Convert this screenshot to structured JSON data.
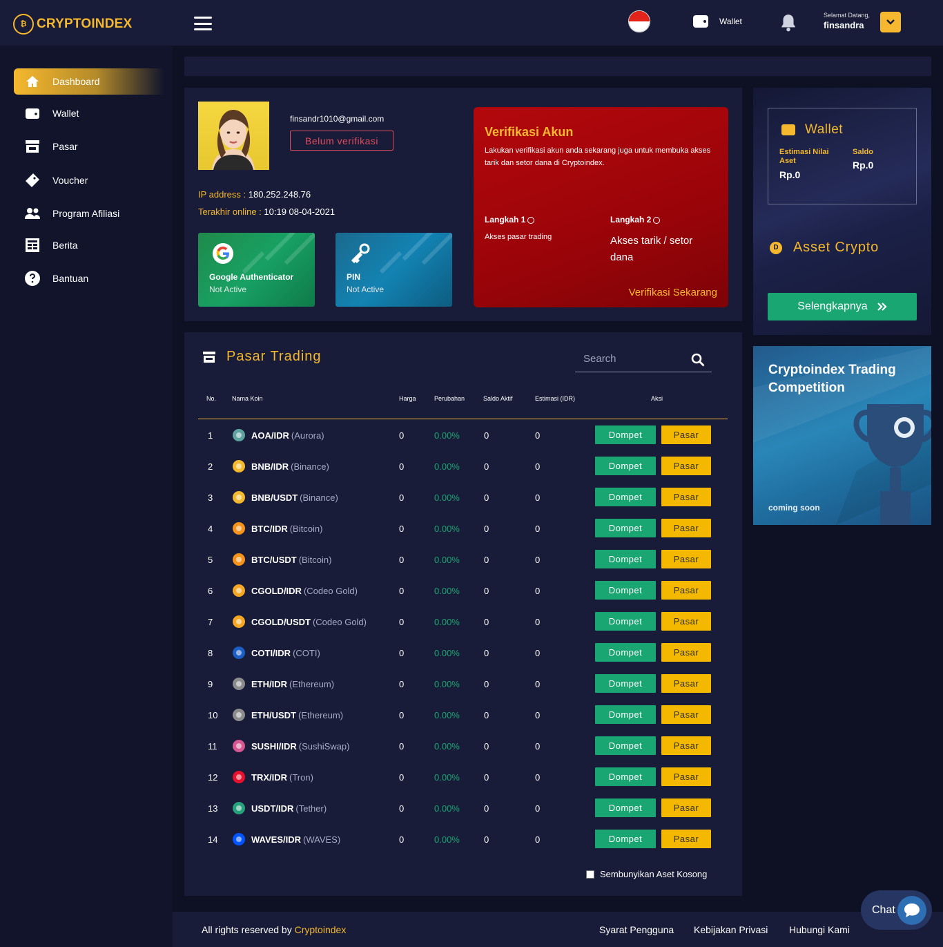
{
  "brand": {
    "name": "CRYPTOINDEX"
  },
  "topbar": {
    "wallet_label": "Wallet",
    "greeting": "Selamat Datang,",
    "username": "finsandra"
  },
  "sidebar": {
    "items": [
      {
        "label": "Dashboard",
        "icon": "home-icon",
        "active": true
      },
      {
        "label": "Wallet",
        "icon": "wallet-icon"
      },
      {
        "label": "Pasar",
        "icon": "store-icon"
      },
      {
        "label": "Voucher",
        "icon": "ticket-icon"
      },
      {
        "label": "Program Afiliasi",
        "icon": "users-icon"
      },
      {
        "label": "Berita",
        "icon": "news-icon"
      },
      {
        "label": "Bantuan",
        "icon": "help-icon"
      }
    ]
  },
  "profile": {
    "email": "finsandr1010@gmail.com",
    "status": "Belum verifikasi",
    "ip_label": "IP address :",
    "ip_value": "180.252.248.76",
    "online_label": "Terakhir online :",
    "online_value": "10:19 08-04-2021"
  },
  "security": {
    "google": {
      "title": "Google Authenticator",
      "status": "Not Active"
    },
    "pin": {
      "title": "PIN",
      "status": "Not Active"
    }
  },
  "verification": {
    "title": "Verifikasi Akun",
    "description": "Lakukan verifikasi akun anda sekarang juga untuk membuka akses tarik dan setor dana di Cryptoindex.",
    "step1_label": "Langkah 1",
    "step1_desc": "Akses pasar trading",
    "step2_label": "Langkah 2",
    "step2_desc": "Akses tarik / setor dana",
    "cta": "Verifikasi Sekarang"
  },
  "wallet_card": {
    "title": "Wallet",
    "estimate_label": "Estimasi Nilai Aset",
    "estimate_value": "Rp.0",
    "saldo_label": "Saldo",
    "saldo_value": "Rp.0",
    "asset_title": "Asset Crypto",
    "more_label": "Selengkapnya"
  },
  "promo": {
    "title": "Cryptoindex Trading Competition",
    "subtitle": "coming soon"
  },
  "market": {
    "title": "Pasar Trading",
    "search_placeholder": "Search",
    "columns": {
      "no": "No.",
      "name": "Nama Koin",
      "price": "Harga",
      "change": "Perubahan",
      "balance": "Saldo Aktif",
      "estimate": "Estimasi (IDR)",
      "action": "Aksi"
    },
    "wallet_btn": "Dompet",
    "market_btn": "Pasar",
    "rows": [
      {
        "no": "1",
        "pair": "AOA/IDR",
        "full": "(Aurora)",
        "price": "0",
        "change": "0.00%",
        "balance": "0",
        "estimate": "0",
        "color": "#5fa3a0"
      },
      {
        "no": "2",
        "pair": "BNB/IDR",
        "full": "(Binance)",
        "price": "0",
        "change": "0.00%",
        "balance": "0",
        "estimate": "0",
        "color": "#f3ba2f"
      },
      {
        "no": "3",
        "pair": "BNB/USDT",
        "full": "(Binance)",
        "price": "0",
        "change": "0.00%",
        "balance": "0",
        "estimate": "0",
        "color": "#f3ba2f"
      },
      {
        "no": "4",
        "pair": "BTC/IDR",
        "full": "(Bitcoin)",
        "price": "0",
        "change": "0.00%",
        "balance": "0",
        "estimate": "0",
        "color": "#f7931a"
      },
      {
        "no": "5",
        "pair": "BTC/USDT",
        "full": "(Bitcoin)",
        "price": "0",
        "change": "0.00%",
        "balance": "0",
        "estimate": "0",
        "color": "#f7931a"
      },
      {
        "no": "6",
        "pair": "CGOLD/IDR",
        "full": "(Codeo Gold)",
        "price": "0",
        "change": "0.00%",
        "balance": "0",
        "estimate": "0",
        "color": "#f5a623"
      },
      {
        "no": "7",
        "pair": "CGOLD/USDT",
        "full": "(Codeo Gold)",
        "price": "0",
        "change": "0.00%",
        "balance": "0",
        "estimate": "0",
        "color": "#f5a623"
      },
      {
        "no": "8",
        "pair": "COTI/IDR",
        "full": "(COTI)",
        "price": "0",
        "change": "0.00%",
        "balance": "0",
        "estimate": "0",
        "color": "#1c5fc4"
      },
      {
        "no": "9",
        "pair": "ETH/IDR",
        "full": "(Ethereum)",
        "price": "0",
        "change": "0.00%",
        "balance": "0",
        "estimate": "0",
        "color": "#8c8c8c"
      },
      {
        "no": "10",
        "pair": "ETH/USDT",
        "full": "(Ethereum)",
        "price": "0",
        "change": "0.00%",
        "balance": "0",
        "estimate": "0",
        "color": "#8c8c8c"
      },
      {
        "no": "11",
        "pair": "SUSHI/IDR",
        "full": "(SushiSwap)",
        "price": "0",
        "change": "0.00%",
        "balance": "0",
        "estimate": "0",
        "color": "#d65892"
      },
      {
        "no": "12",
        "pair": "TRX/IDR",
        "full": "(Tron)",
        "price": "0",
        "change": "0.00%",
        "balance": "0",
        "estimate": "0",
        "color": "#e8112d"
      },
      {
        "no": "13",
        "pair": "USDT/IDR",
        "full": "(Tether)",
        "price": "0",
        "change": "0.00%",
        "balance": "0",
        "estimate": "0",
        "color": "#26a17b"
      },
      {
        "no": "14",
        "pair": "WAVES/IDR",
        "full": "(WAVES)",
        "price": "0",
        "change": "0.00%",
        "balance": "0",
        "estimate": "0",
        "color": "#0155ff"
      }
    ],
    "hide_empty_label": "Sembunyikan Aset Kosong"
  },
  "footer": {
    "copyright": "All rights reserved by",
    "brand": "Cryptoindex",
    "links": [
      "Syarat Pengguna",
      "Kebijakan Privasi",
      "Hubungi Kami"
    ]
  },
  "chat": {
    "label": "Chat"
  }
}
